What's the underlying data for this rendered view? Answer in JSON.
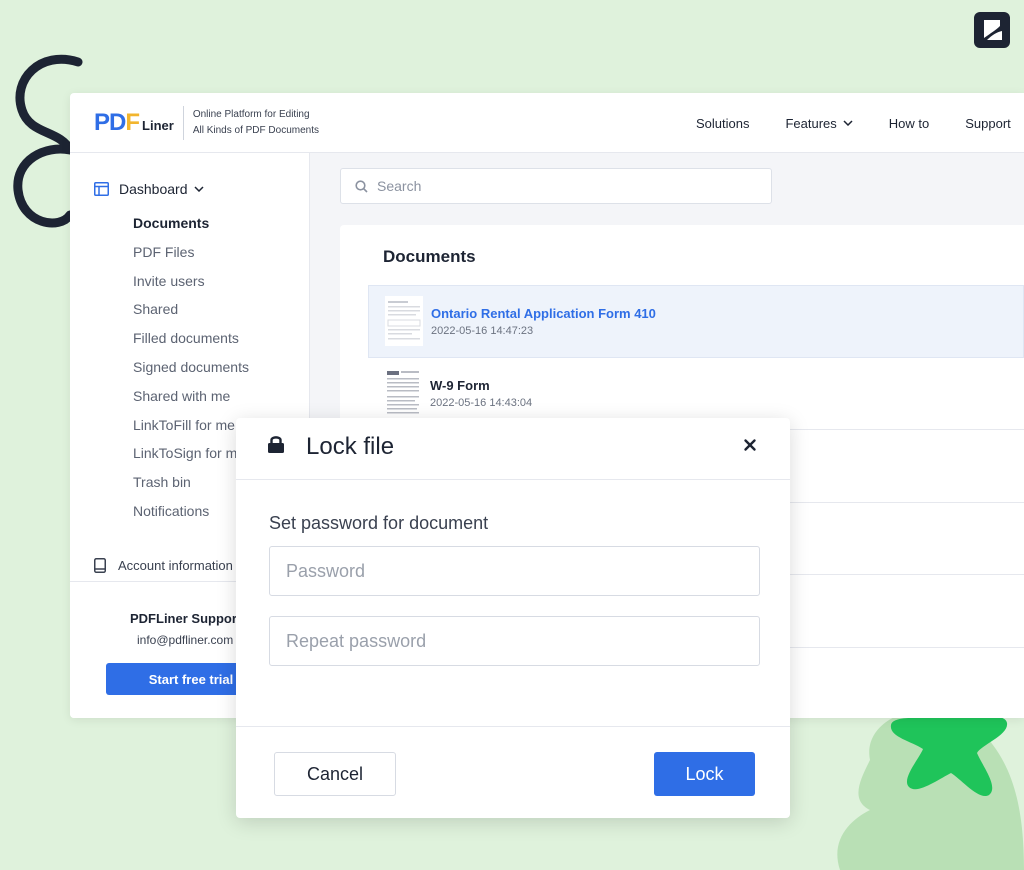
{
  "header": {
    "logo_pdf_p": "P",
    "logo_pdf_d": "D",
    "logo_pdf_f": "F",
    "logo_liner": "Liner",
    "tagline_line1": "Online Platform for Editing",
    "tagline_line2": "All Kinds of PDF Documents",
    "nav": [
      {
        "label": "Solutions"
      },
      {
        "label": "Features"
      },
      {
        "label": "How to"
      },
      {
        "label": "Support"
      }
    ]
  },
  "sidebar": {
    "dashboard_label": "Dashboard",
    "items": [
      {
        "label": "Documents"
      },
      {
        "label": "PDF Files"
      },
      {
        "label": "Invite users"
      },
      {
        "label": "Shared"
      },
      {
        "label": "Filled documents"
      },
      {
        "label": "Signed documents"
      },
      {
        "label": "Shared with me"
      },
      {
        "label": "LinkToFill for me"
      },
      {
        "label": "LinkToSign for me"
      },
      {
        "label": "Trash bin"
      },
      {
        "label": "Notifications"
      }
    ],
    "account_label": "Account information",
    "support_name": "PDFLiner Support",
    "support_email": "info@pdfliner.com",
    "trial_button": "Start free trial"
  },
  "content": {
    "search_placeholder": "Search",
    "docs_title": "Documents",
    "documents": [
      {
        "name": "Ontario Rental Application Form 410",
        "date": "2022-05-16 14:47:23"
      },
      {
        "name": "W-9 Form",
        "date": "2022-05-16 14:43:04"
      },
      {
        "name": "",
        "date": ""
      },
      {
        "name": "",
        "date": ""
      },
      {
        "name": "",
        "date": ""
      }
    ]
  },
  "modal": {
    "title": "Lock file",
    "label": "Set password for document",
    "password_placeholder": "Password",
    "repeat_placeholder": "Repeat password",
    "cancel_label": "Cancel",
    "lock_label": "Lock"
  },
  "colors": {
    "accent": "#2f6ee6",
    "logo_f": "#f2b52d",
    "background": "#dff2dc",
    "star": "#1fc45a"
  }
}
